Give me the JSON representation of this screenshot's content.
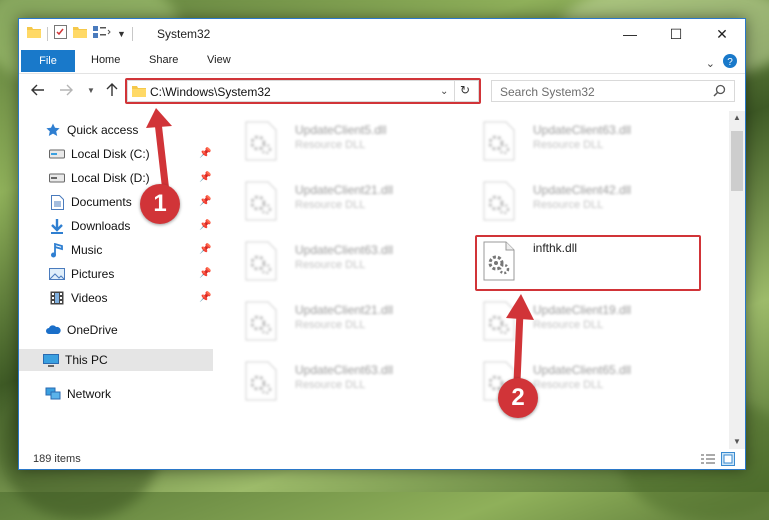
{
  "window": {
    "title": "System32",
    "controls": {
      "minimize": "—",
      "maximize": "☐",
      "close": "✕"
    }
  },
  "ribbon": {
    "file": "File",
    "tabs": [
      "Home",
      "Share",
      "View"
    ]
  },
  "address": {
    "path": "C:\\Windows\\System32",
    "search_placeholder": "Search System32"
  },
  "nav": {
    "quick_access": "Quick access",
    "items": [
      {
        "label": "Local Disk (C:)",
        "icon": "drive-icon",
        "pinned": true
      },
      {
        "label": "Local Disk (D:)",
        "icon": "drive-icon",
        "pinned": true
      },
      {
        "label": "Documents",
        "icon": "documents-icon",
        "pinned": true
      },
      {
        "label": "Downloads",
        "icon": "download-icon",
        "pinned": true
      },
      {
        "label": "Music",
        "icon": "music-icon",
        "pinned": true
      },
      {
        "label": "Pictures",
        "icon": "pictures-icon",
        "pinned": true
      },
      {
        "label": "Videos",
        "icon": "videos-icon",
        "pinned": true
      }
    ],
    "onedrive": "OneDrive",
    "this_pc": "This PC",
    "network": "Network"
  },
  "files": [
    {
      "name": "UpdateClient5.dll",
      "type": "Resource DLL"
    },
    {
      "name": "UpdateClient63.dll",
      "type": "Resource DLL"
    },
    {
      "name": "UpdateClient21.dll",
      "type": "Resource DLL"
    },
    {
      "name": "UpdateClient42.dll",
      "type": "Resource DLL"
    },
    {
      "name": "UpdateClient63.dll",
      "type": "Resource DLL"
    },
    {
      "name": "infthk.dll",
      "type": ""
    },
    {
      "name": "UpdateClient21.dll",
      "type": "Resource DLL"
    },
    {
      "name": "UpdateClient19.dll",
      "type": "Resource DLL"
    },
    {
      "name": "UpdateClient63.dll",
      "type": "Resource DLL"
    },
    {
      "name": "UpdateClient65.dll",
      "type": "Resource DLL"
    }
  ],
  "status": {
    "count": "189 items"
  },
  "annotations": {
    "step1": "1",
    "step2": "2"
  },
  "colors": {
    "accent": "#1979ca",
    "highlight": "#d13438"
  }
}
